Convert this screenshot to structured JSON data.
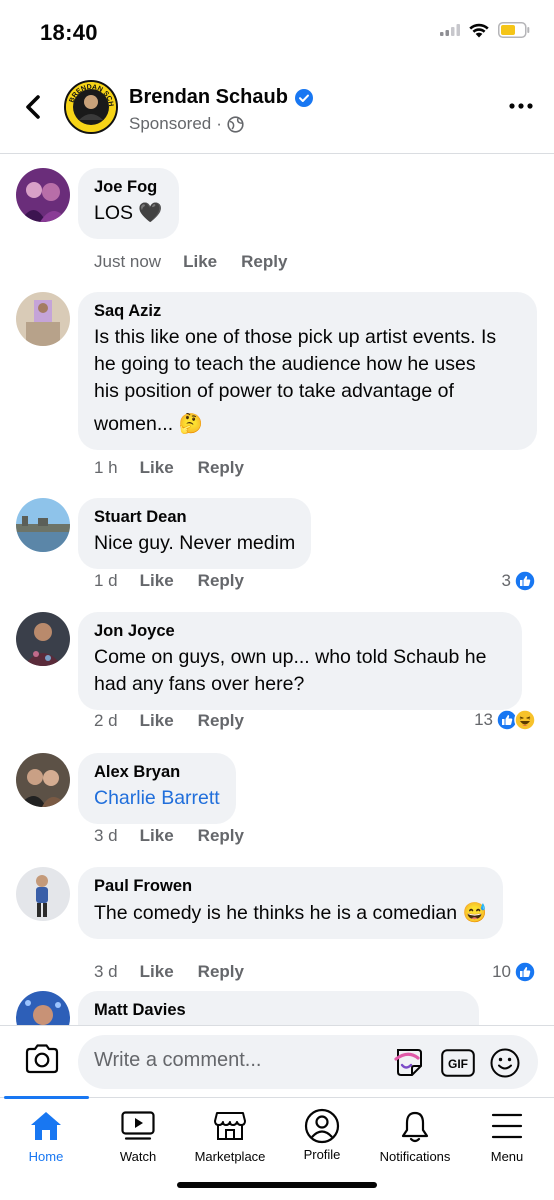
{
  "status_bar": {
    "time": "18:40"
  },
  "header": {
    "page_name": "Brendan Schaub",
    "subtitle": "Sponsored",
    "separator": "·",
    "avatar_logo_text": "BRENDAN SCHAUB"
  },
  "comments": [
    {
      "name": "Joe Fog",
      "lines": [
        "LOS 🖤"
      ],
      "time": "Just now",
      "like": "Like",
      "reply": "Reply",
      "reaction_count": ""
    },
    {
      "name": "Saq Aziz",
      "lines": [
        "Is this like one of those pick up artist events. Is",
        "he going to teach the audience how he uses",
        "his position of power to take advantage of",
        "women... 🤔"
      ],
      "time": "1 h",
      "like": "Like",
      "reply": "Reply",
      "reaction_count": ""
    },
    {
      "name": "Stuart Dean",
      "lines": [
        "Nice guy. Never medim"
      ],
      "time": "1 d",
      "like": "Like",
      "reply": "Reply",
      "reaction_count": "3"
    },
    {
      "name": "Jon Joyce",
      "lines": [
        "Come on guys, own up... who told Schaub he",
        "had any fans over here?"
      ],
      "time": "2 d",
      "like": "Like",
      "reply": "Reply",
      "reaction_count": "13"
    },
    {
      "name": "Alex Bryan",
      "tag": "Charlie Barrett",
      "time": "3 d",
      "like": "Like",
      "reply": "Reply",
      "reaction_count": ""
    },
    {
      "name": "Paul Frowen",
      "lines": [
        "The comedy is he thinks he is a comedian 😅"
      ],
      "time": "3 d",
      "like": "Like",
      "reply": "Reply",
      "reaction_count": "10"
    },
    {
      "name": "Matt Davies"
    }
  ],
  "composer": {
    "placeholder": "Write a comment...",
    "gif_label": "GIF"
  },
  "tabs": [
    {
      "label": "Home",
      "icon": "home-icon",
      "active": true
    },
    {
      "label": "Watch",
      "icon": "watch-icon"
    },
    {
      "label": "Marketplace",
      "icon": "marketplace-icon"
    },
    {
      "label": "Profile",
      "icon": "profile-icon"
    },
    {
      "label": "Notifications",
      "icon": "bell-icon"
    },
    {
      "label": "Menu",
      "icon": "menu-icon"
    }
  ],
  "colors": {
    "accent": "#1877f2",
    "link": "#216fdb",
    "bubble": "#f0f2f5",
    "secondary_text": "#65676b"
  }
}
